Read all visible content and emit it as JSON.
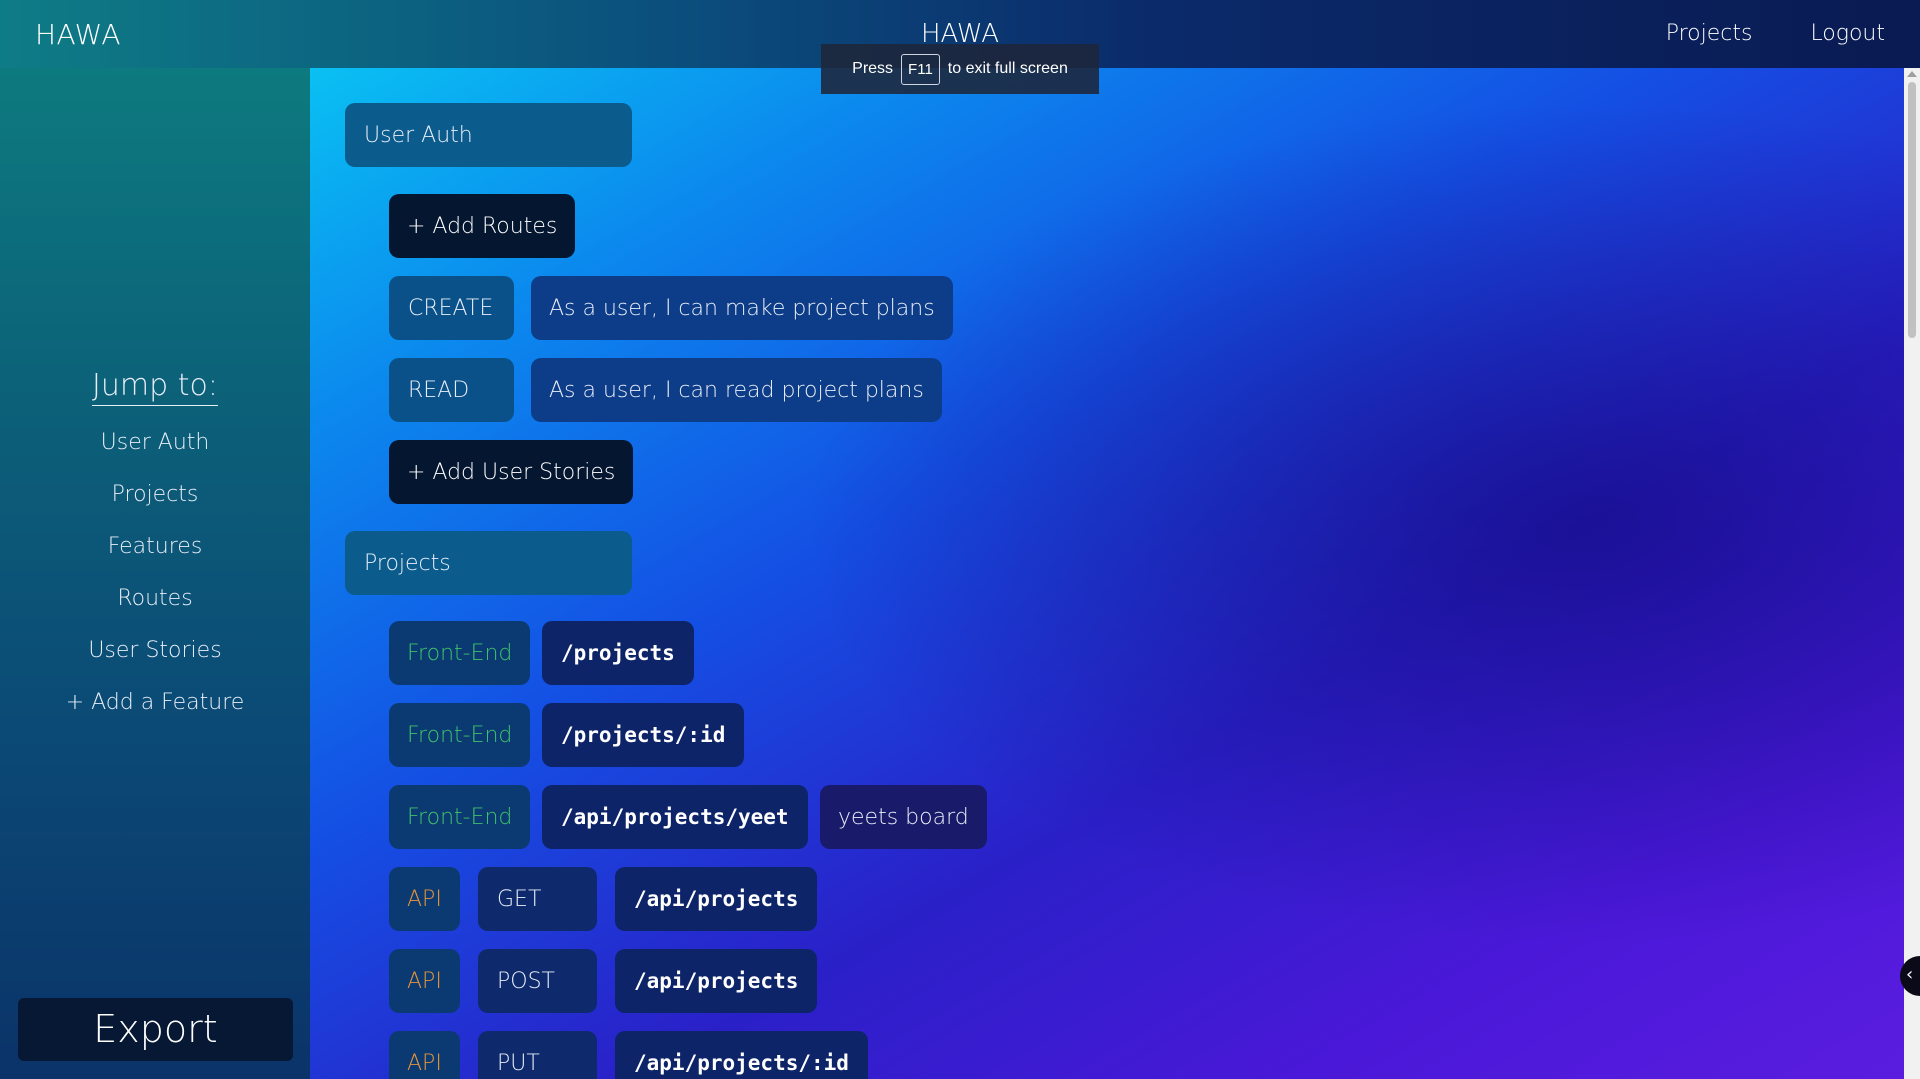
{
  "navbar": {
    "brand": "HAWA",
    "center_title": "HAWA",
    "links": [
      "Projects",
      "Logout"
    ]
  },
  "fullscreen_notice": {
    "prefix": "Press",
    "key": "F11",
    "suffix": "to exit full screen"
  },
  "sidebar": {
    "jump_title": "Jump to:",
    "items": [
      "User Auth",
      "Projects",
      "Features",
      "Routes",
      "User Stories",
      "+ Add a Feature"
    ],
    "export_label": "Export"
  },
  "features": [
    {
      "name": "User Auth",
      "add_routes_label": "+ Add Routes",
      "user_stories": [
        {
          "crud": "CREATE",
          "text": "As a user, I can make project plans"
        },
        {
          "crud": "READ",
          "text": "As a user, I can read project plans"
        }
      ],
      "add_stories_label": "+ Add User Stories"
    },
    {
      "name": "Projects",
      "routes": [
        {
          "type": "Front-End",
          "path": "/projects"
        },
        {
          "type": "Front-End",
          "path": "/projects/:id"
        },
        {
          "type": "Front-End",
          "path": "/api/projects/yeet",
          "note": "yeets board"
        },
        {
          "type": "API",
          "method": "GET",
          "path": "/api/projects"
        },
        {
          "type": "API",
          "method": "POST",
          "path": "/api/projects"
        },
        {
          "type": "API",
          "method": "PUT",
          "path": "/api/projects/:id"
        }
      ]
    }
  ],
  "colors": {
    "front_end_tag": "#3fc26a",
    "api_tag": "#e6953a"
  }
}
